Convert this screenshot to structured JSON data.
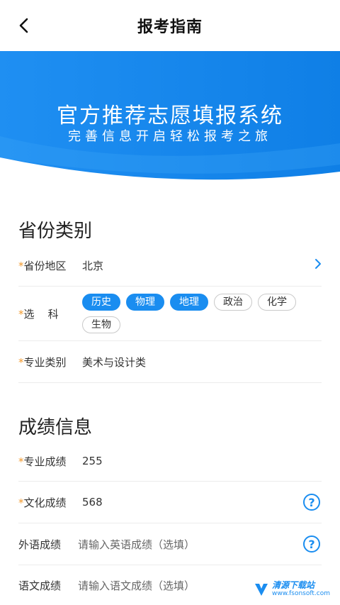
{
  "header": {
    "title": "报考指南"
  },
  "banner": {
    "title": "官方推荐志愿填报系统",
    "subtitle": "完善信息开启轻松报考之旅",
    "color": "#1a8df0"
  },
  "province_section": {
    "title": "省份类别",
    "province": {
      "required": "*",
      "label": "省份地区",
      "value": "北京"
    },
    "subjects": {
      "required": "*",
      "label": "选    科",
      "options": [
        {
          "label": "历史",
          "selected": true
        },
        {
          "label": "物理",
          "selected": true
        },
        {
          "label": "地理",
          "selected": true
        },
        {
          "label": "政治",
          "selected": false
        },
        {
          "label": "化学",
          "selected": false
        },
        {
          "label": "生物",
          "selected": false
        }
      ]
    },
    "major": {
      "required": "*",
      "label": "专业类别",
      "value": "美术与设计类"
    }
  },
  "score_section": {
    "title": "成绩信息",
    "professional": {
      "required": "*",
      "label": "专业成绩",
      "value": "255"
    },
    "culture": {
      "required": "*",
      "label": "文化成绩",
      "value": "568"
    },
    "english": {
      "label": "外语成绩",
      "placeholder": "请输入英语成绩（选填）"
    },
    "chinese": {
      "label": "语文成绩",
      "placeholder": "请输入语文成绩（选填）"
    }
  },
  "watermark": {
    "name": "清源下载站",
    "url": "www.fsonsoft.com"
  }
}
